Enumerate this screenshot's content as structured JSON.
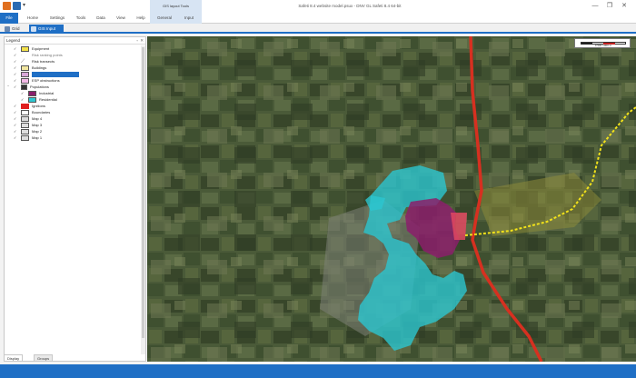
{
  "titlebar": {
    "contextual_group": "GIS layout Tools",
    "window_title": "Safeti 8.4 website model.psux - DNV GL Safeti 8.4 64-bit",
    "minimize": "—",
    "restore": "❐",
    "close": "✕"
  },
  "ribbon": {
    "tabs": [
      "File",
      "Home",
      "Settings",
      "Tools",
      "Data",
      "View",
      "Help",
      "General",
      "Input"
    ]
  },
  "document_tabs": [
    "Grid",
    "GIS Input"
  ],
  "legend": {
    "title": "Legend",
    "pin": "📌",
    "close": "✕",
    "items": [
      {
        "label": "Equipment",
        "symbol": "equipment-icon"
      },
      {
        "label": "Risk ranking points",
        "symbol": "risk-points-icon"
      },
      {
        "label": "Risk transects",
        "symbol": "transect-icon"
      },
      {
        "label": "Buildings",
        "symbol": "buildings-icon"
      },
      {
        "label": "",
        "symbol": "layer-icon"
      },
      {
        "label": "ESP obstructions",
        "symbol": "obstruction-icon"
      },
      {
        "label": "Populations",
        "symbol": "population-icon"
      },
      {
        "label": "Industrial",
        "symbol": "industrial-swatch"
      },
      {
        "label": "Residential",
        "symbol": "residential-swatch"
      },
      {
        "label": "Ignitions",
        "symbol": "ignition-icon"
      },
      {
        "label": "Boundaries",
        "symbol": "boundary-icon"
      },
      {
        "label": "Map 4",
        "symbol": "map-icon"
      },
      {
        "label": "Map 3",
        "symbol": "map-icon"
      },
      {
        "label": "Map 2",
        "symbol": "map-icon"
      },
      {
        "label": "Map 1",
        "symbol": "map-icon"
      }
    ],
    "checkmark": "✓",
    "expander_open": "−",
    "expander_closed": "+"
  },
  "panel_tabs": [
    "Display Order",
    "Groups"
  ],
  "map": {
    "scale_label": "0      500      1000 m"
  },
  "colors": {
    "accent": "#1f6fc5",
    "industrial": "#8b1f6b",
    "residential": "#2cc6d0",
    "road": "#d63020",
    "route": "#f2e21a"
  }
}
